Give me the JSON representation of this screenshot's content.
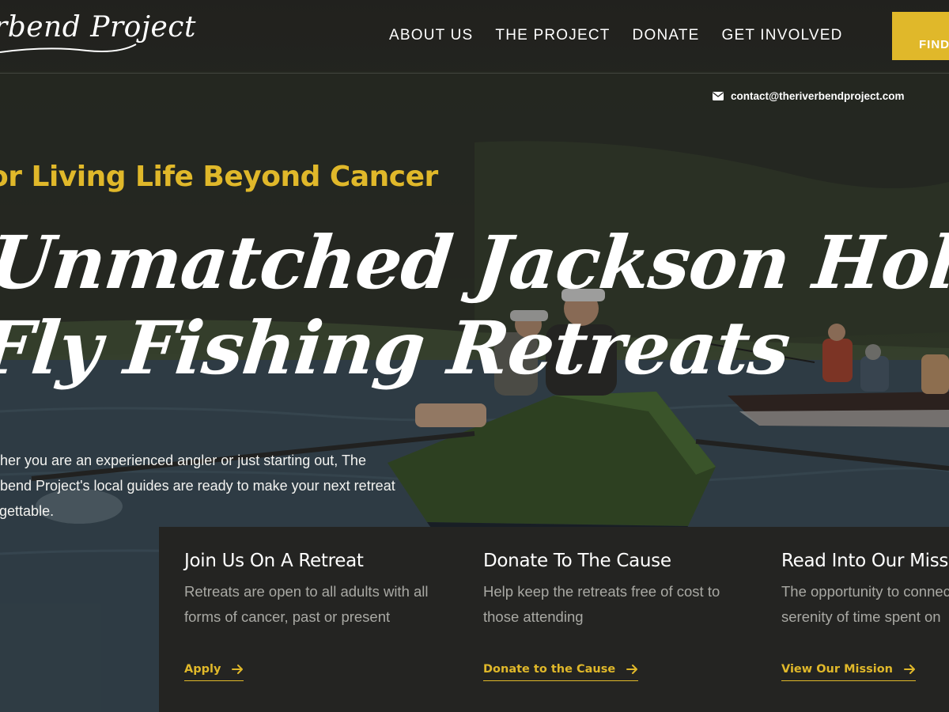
{
  "header": {
    "logo_text": "rbend Project",
    "nav": [
      {
        "label": "ABOUT US"
      },
      {
        "label": "THE PROJECT"
      },
      {
        "label": "DONATE"
      },
      {
        "label": "GET INVOLVED"
      }
    ],
    "cta_label": "FIND",
    "contact_email": "contact@theriverbendproject.com"
  },
  "hero": {
    "tagline": "or Living Life Beyond Cancer",
    "title_line1": "Unmatched Jackson Hole",
    "title_line2": "Fly Fishing Retreats",
    "intro_line1": "Whether you are an experienced angler or just starting out, The",
    "intro_line2": "Riverbend Project's local guides are ready to make your next retreat",
    "intro_line3": "unforgettable."
  },
  "cards": [
    {
      "title": "Join Us On A Retreat",
      "text_line1": "Retreats are open to all adults with all",
      "text_line2": "forms of cancer, past or present",
      "link": "Apply"
    },
    {
      "title": "Donate To The Cause",
      "text_line1": "Help keep the retreats free of cost to",
      "text_line2": "those attending",
      "link": "Donate to the Cause"
    },
    {
      "title": "Read Into Our Mission",
      "text_line1": "The opportunity to connect",
      "text_line2": "serenity of time spent on",
      "link": "View Our Mission"
    }
  ],
  "colors": {
    "accent": "#e0b82a",
    "panel": "#242422",
    "muted_text": "#a9a9a4"
  }
}
